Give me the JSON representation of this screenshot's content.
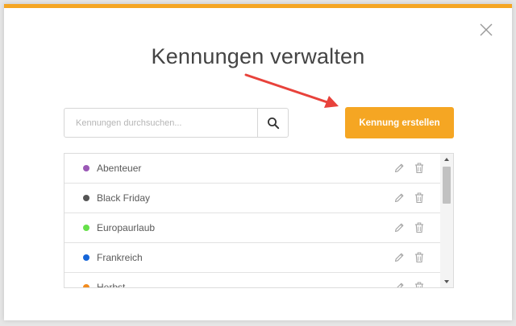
{
  "modal": {
    "title": "Kennungen verwalten",
    "accent_color": "#f5a623"
  },
  "search": {
    "placeholder": "Kennungen durchsuchen...",
    "value": "",
    "icon": "search-icon"
  },
  "create_button": {
    "label": "Kennung erstellen",
    "color": "#f5a623"
  },
  "annotation": {
    "arrow_color": "#e8423b"
  },
  "tags": [
    {
      "label": "Abenteuer",
      "color": "#9b59b6"
    },
    {
      "label": "Black Friday",
      "color": "#555555"
    },
    {
      "label": "Europaurlaub",
      "color": "#66e04a"
    },
    {
      "label": "Frankreich",
      "color": "#1565d8"
    },
    {
      "label": "Herbst",
      "color": "#f28c1e"
    }
  ],
  "row_icons": {
    "edit": "pencil-icon",
    "delete": "trash-icon"
  }
}
